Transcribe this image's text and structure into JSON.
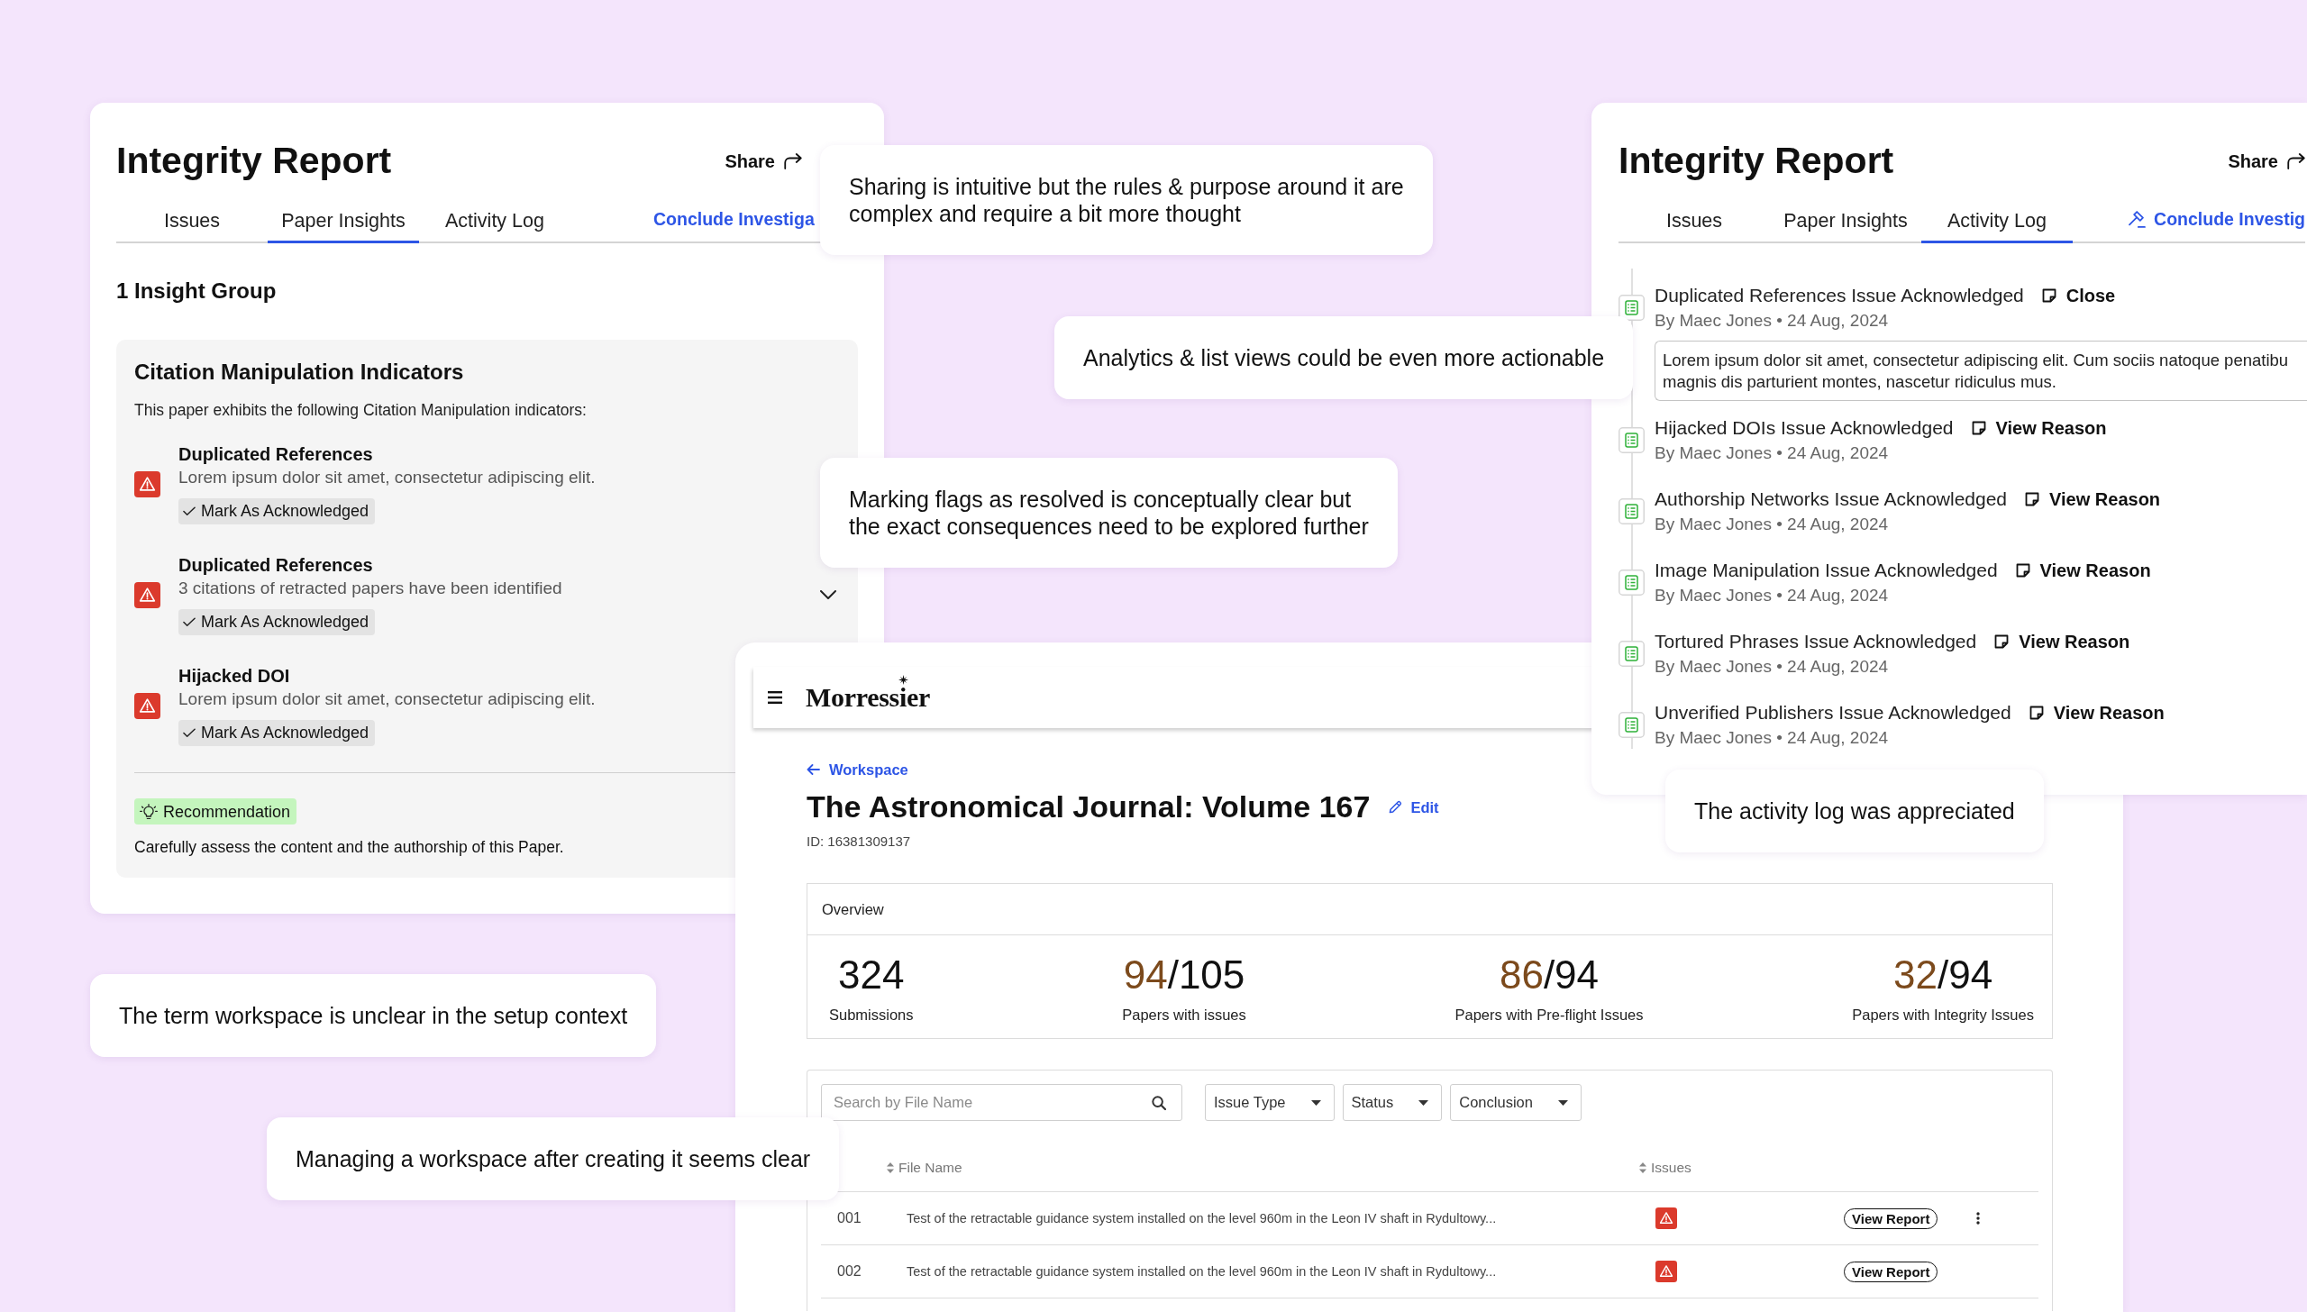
{
  "insights_report": {
    "title": "Integrity Report",
    "share_label": "Share",
    "tabs": [
      {
        "label": "Issues",
        "selected": false
      },
      {
        "label": "Paper Insights",
        "selected": true
      },
      {
        "label": "Activity Log",
        "selected": false
      }
    ],
    "conclude": {
      "label": "Conclude Investiga",
      "icon": false
    },
    "group_count": "1 Insight Group",
    "group": {
      "title": "Citation Manipulation Indicators",
      "intro": "This paper exhibits the following Citation Manipulation indicators:",
      "collapsible": true,
      "indicators": [
        {
          "title": "Duplicated References",
          "description": "Lorem ipsum dolor sit amet, consectetur adipiscing elit.",
          "action": "Mark As Acknowledged"
        },
        {
          "title": "Duplicated References",
          "description": "3 citations of retracted papers have been identified",
          "action": "Mark As Acknowledged"
        },
        {
          "title": "Hijacked DOI",
          "description": "Lorem ipsum dolor sit amet, consectetur adipiscing elit.",
          "action": "Mark As Acknowledged"
        }
      ],
      "recommendation": {
        "label": "Recommendation",
        "text": "Carefully assess the content and the authorship of this Paper."
      }
    }
  },
  "activity_report": {
    "title": "Integrity Report",
    "share_label": "Share",
    "tabs": [
      {
        "label": "Issues",
        "selected": false
      },
      {
        "label": "Paper Insights",
        "selected": false
      },
      {
        "label": "Activity Log",
        "selected": true
      }
    ],
    "conclude": {
      "label": "Conclude Investig",
      "icon": true
    },
    "events": [
      {
        "title": "Duplicated References Issue Acknowledged",
        "action": "Close",
        "byline": "By Maec Jones • 24 Aug, 2024",
        "expanded": true,
        "reason_lines": [
          "Lorem ipsum dolor sit amet, consectetur adipiscing elit. Cum sociis natoque penatibu",
          "magnis dis parturient montes, nascetur ridiculus mus."
        ]
      },
      {
        "title": "Hijacked DOIs Issue Acknowledged",
        "action": "View Reason",
        "byline": "By Maec Jones • 24 Aug, 2024",
        "expanded": false
      },
      {
        "title": "Authorship Networks Issue Acknowledged",
        "action": "View Reason",
        "byline": "By Maec Jones • 24 Aug, 2024",
        "expanded": false
      },
      {
        "title": "Image Manipulation Issue Acknowledged",
        "action": "View Reason",
        "byline": "By Maec Jones • 24 Aug, 2024",
        "expanded": false
      },
      {
        "title": "Tortured Phrases Issue Acknowledged",
        "action": "View Reason",
        "byline": "By Maec Jones • 24 Aug, 2024",
        "expanded": false
      },
      {
        "title": "Unverified Publishers Issue Acknowledged",
        "action": "View Reason",
        "byline": "By Maec Jones • 24 Aug, 2024",
        "expanded": false
      }
    ]
  },
  "workspace_window": {
    "brand": "Morressier",
    "back_link": "Workspace",
    "title": "The Astronomical Journal: Volume 167",
    "edit_label": "Edit",
    "id_line": "ID: 16381309137",
    "overview": {
      "heading": "Overview",
      "stats": [
        {
          "value": "324",
          "highlighted": false,
          "label": "Submissions"
        },
        {
          "value": "94",
          "highlighted": true,
          "total": "/105",
          "label": "Papers with issues"
        },
        {
          "value": "86",
          "highlighted": true,
          "total": "/94",
          "label": "Papers with Pre-flight Issues"
        },
        {
          "value": "32",
          "highlighted": true,
          "total": "/94",
          "label": "Papers with Integrity Issues"
        }
      ]
    },
    "filters": {
      "search_placeholder": "Search by File Name",
      "dropdowns": [
        "Issue Type",
        "Status",
        "Conclusion"
      ]
    },
    "table": {
      "columns": [
        {
          "label": "File Name",
          "sortable": true
        },
        {
          "label": "Issues",
          "sortable": true
        }
      ],
      "rows": [
        {
          "number": "001",
          "file_name": "Test of the retractable guidance system installed on the level 960m in the Leon IV shaft in Rydultowy...",
          "flagged": true,
          "action": "View Report",
          "has_menu": true
        },
        {
          "number": "002",
          "file_name": "Test of the retractable guidance system installed on the level 960m in the Leon IV shaft in Rydultowy...",
          "flagged": true,
          "action": "View Report",
          "has_menu": false
        }
      ]
    }
  },
  "feedback_notes": [
    {
      "lines": [
        "Sharing is intuitive but the rules & purpose around it are",
        "complex and require a bit more thought"
      ]
    },
    {
      "lines": [
        "Analytics & list views could be even more actionable"
      ]
    },
    {
      "lines": [
        "Marking flags as resolved is conceptually clear but",
        "the exact consequences need to be explored further"
      ]
    },
    {
      "lines": [
        "The term workspace is unclear in the setup context"
      ]
    },
    {
      "lines": [
        "Managing a workspace after creating it seems clear"
      ]
    },
    {
      "lines": [
        "The activity log was appreciated"
      ]
    }
  ]
}
